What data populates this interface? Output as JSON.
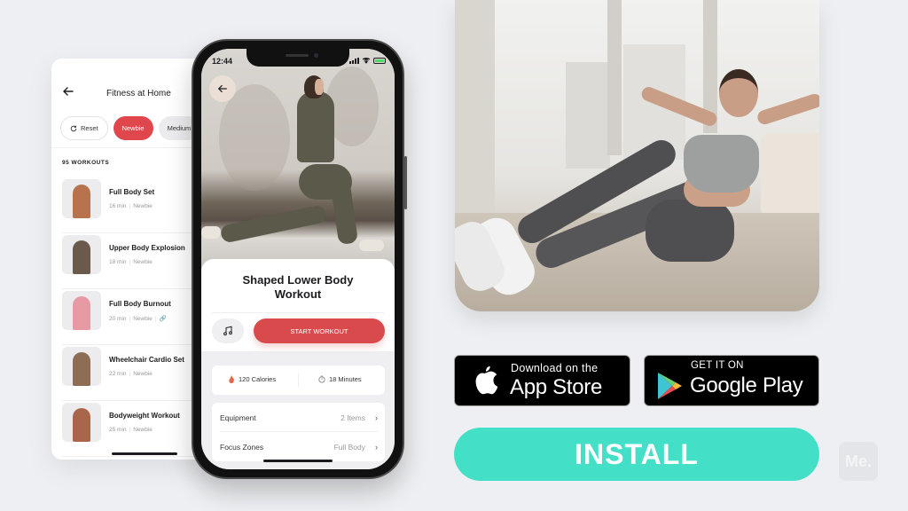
{
  "list_screen": {
    "title": "Fitness at Home",
    "back_icon": "arrow-left-icon",
    "filters": [
      {
        "label": "Reset",
        "icon": "refresh-icon",
        "state": "default"
      },
      {
        "label": "Newbie",
        "state": "selected"
      },
      {
        "label": "Medium",
        "state": "default"
      }
    ],
    "count_label": "95 WORKOUTS",
    "workouts": [
      {
        "name": "Full Body Set",
        "duration": "16 min",
        "level": "Newbie",
        "thumb_color": "#b8734e"
      },
      {
        "name": "Upper Body Explosion",
        "duration": "18 min",
        "level": "Newbie",
        "thumb_color": "#6b5a4c"
      },
      {
        "name": "Full Body Burnout",
        "duration": "20 min",
        "level": "Newbie",
        "extra_icon": "link-icon",
        "thumb_color": "#e79aa4"
      },
      {
        "name": "Wheelchair Cardio Set",
        "duration": "22 min",
        "level": "Newbie",
        "thumb_color": "#8d6e55"
      },
      {
        "name": "Bodyweight Workout",
        "duration": "25 min",
        "level": "Newbie",
        "thumb_color": "#a9664a"
      }
    ]
  },
  "detail_screen": {
    "status_time": "12:44",
    "back_icon": "arrow-left-icon",
    "title_line1": "Shaped Lower Body",
    "title_line2": "Workout",
    "music_icon": "music-note-icon",
    "start_label": "START WORKOUT",
    "stats": {
      "calories": "120 Calories",
      "calories_icon": "flame-icon",
      "minutes": "18 Minutes",
      "minutes_icon": "stopwatch-icon"
    },
    "rows": [
      {
        "label": "Equipment",
        "value": "2 Items"
      },
      {
        "label": "Focus Zones",
        "value": "Full Body"
      }
    ]
  },
  "store_badges": {
    "apple": {
      "small": "Download on the",
      "big": "App Store",
      "icon": "apple-icon"
    },
    "google": {
      "small": "GET IT ON",
      "big": "Google Play",
      "icon": "google-play-icon"
    }
  },
  "install_label": "INSTALL",
  "watermark": "Me.",
  "colors": {
    "accent_red": "#e0474c",
    "install_teal": "#44dfc7",
    "background": "#eeeff2"
  }
}
